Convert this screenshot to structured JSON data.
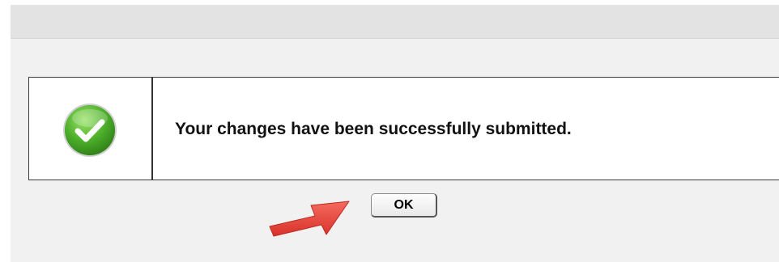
{
  "dialog": {
    "message": "Your changes have been successfully submitted.",
    "ok_label": "OK"
  },
  "icons": {
    "status": "success-check-icon",
    "annotation": "red-arrow-pointer-icon"
  },
  "colors": {
    "success_green": "#4caf2a",
    "arrow_red": "#e8453c"
  }
}
